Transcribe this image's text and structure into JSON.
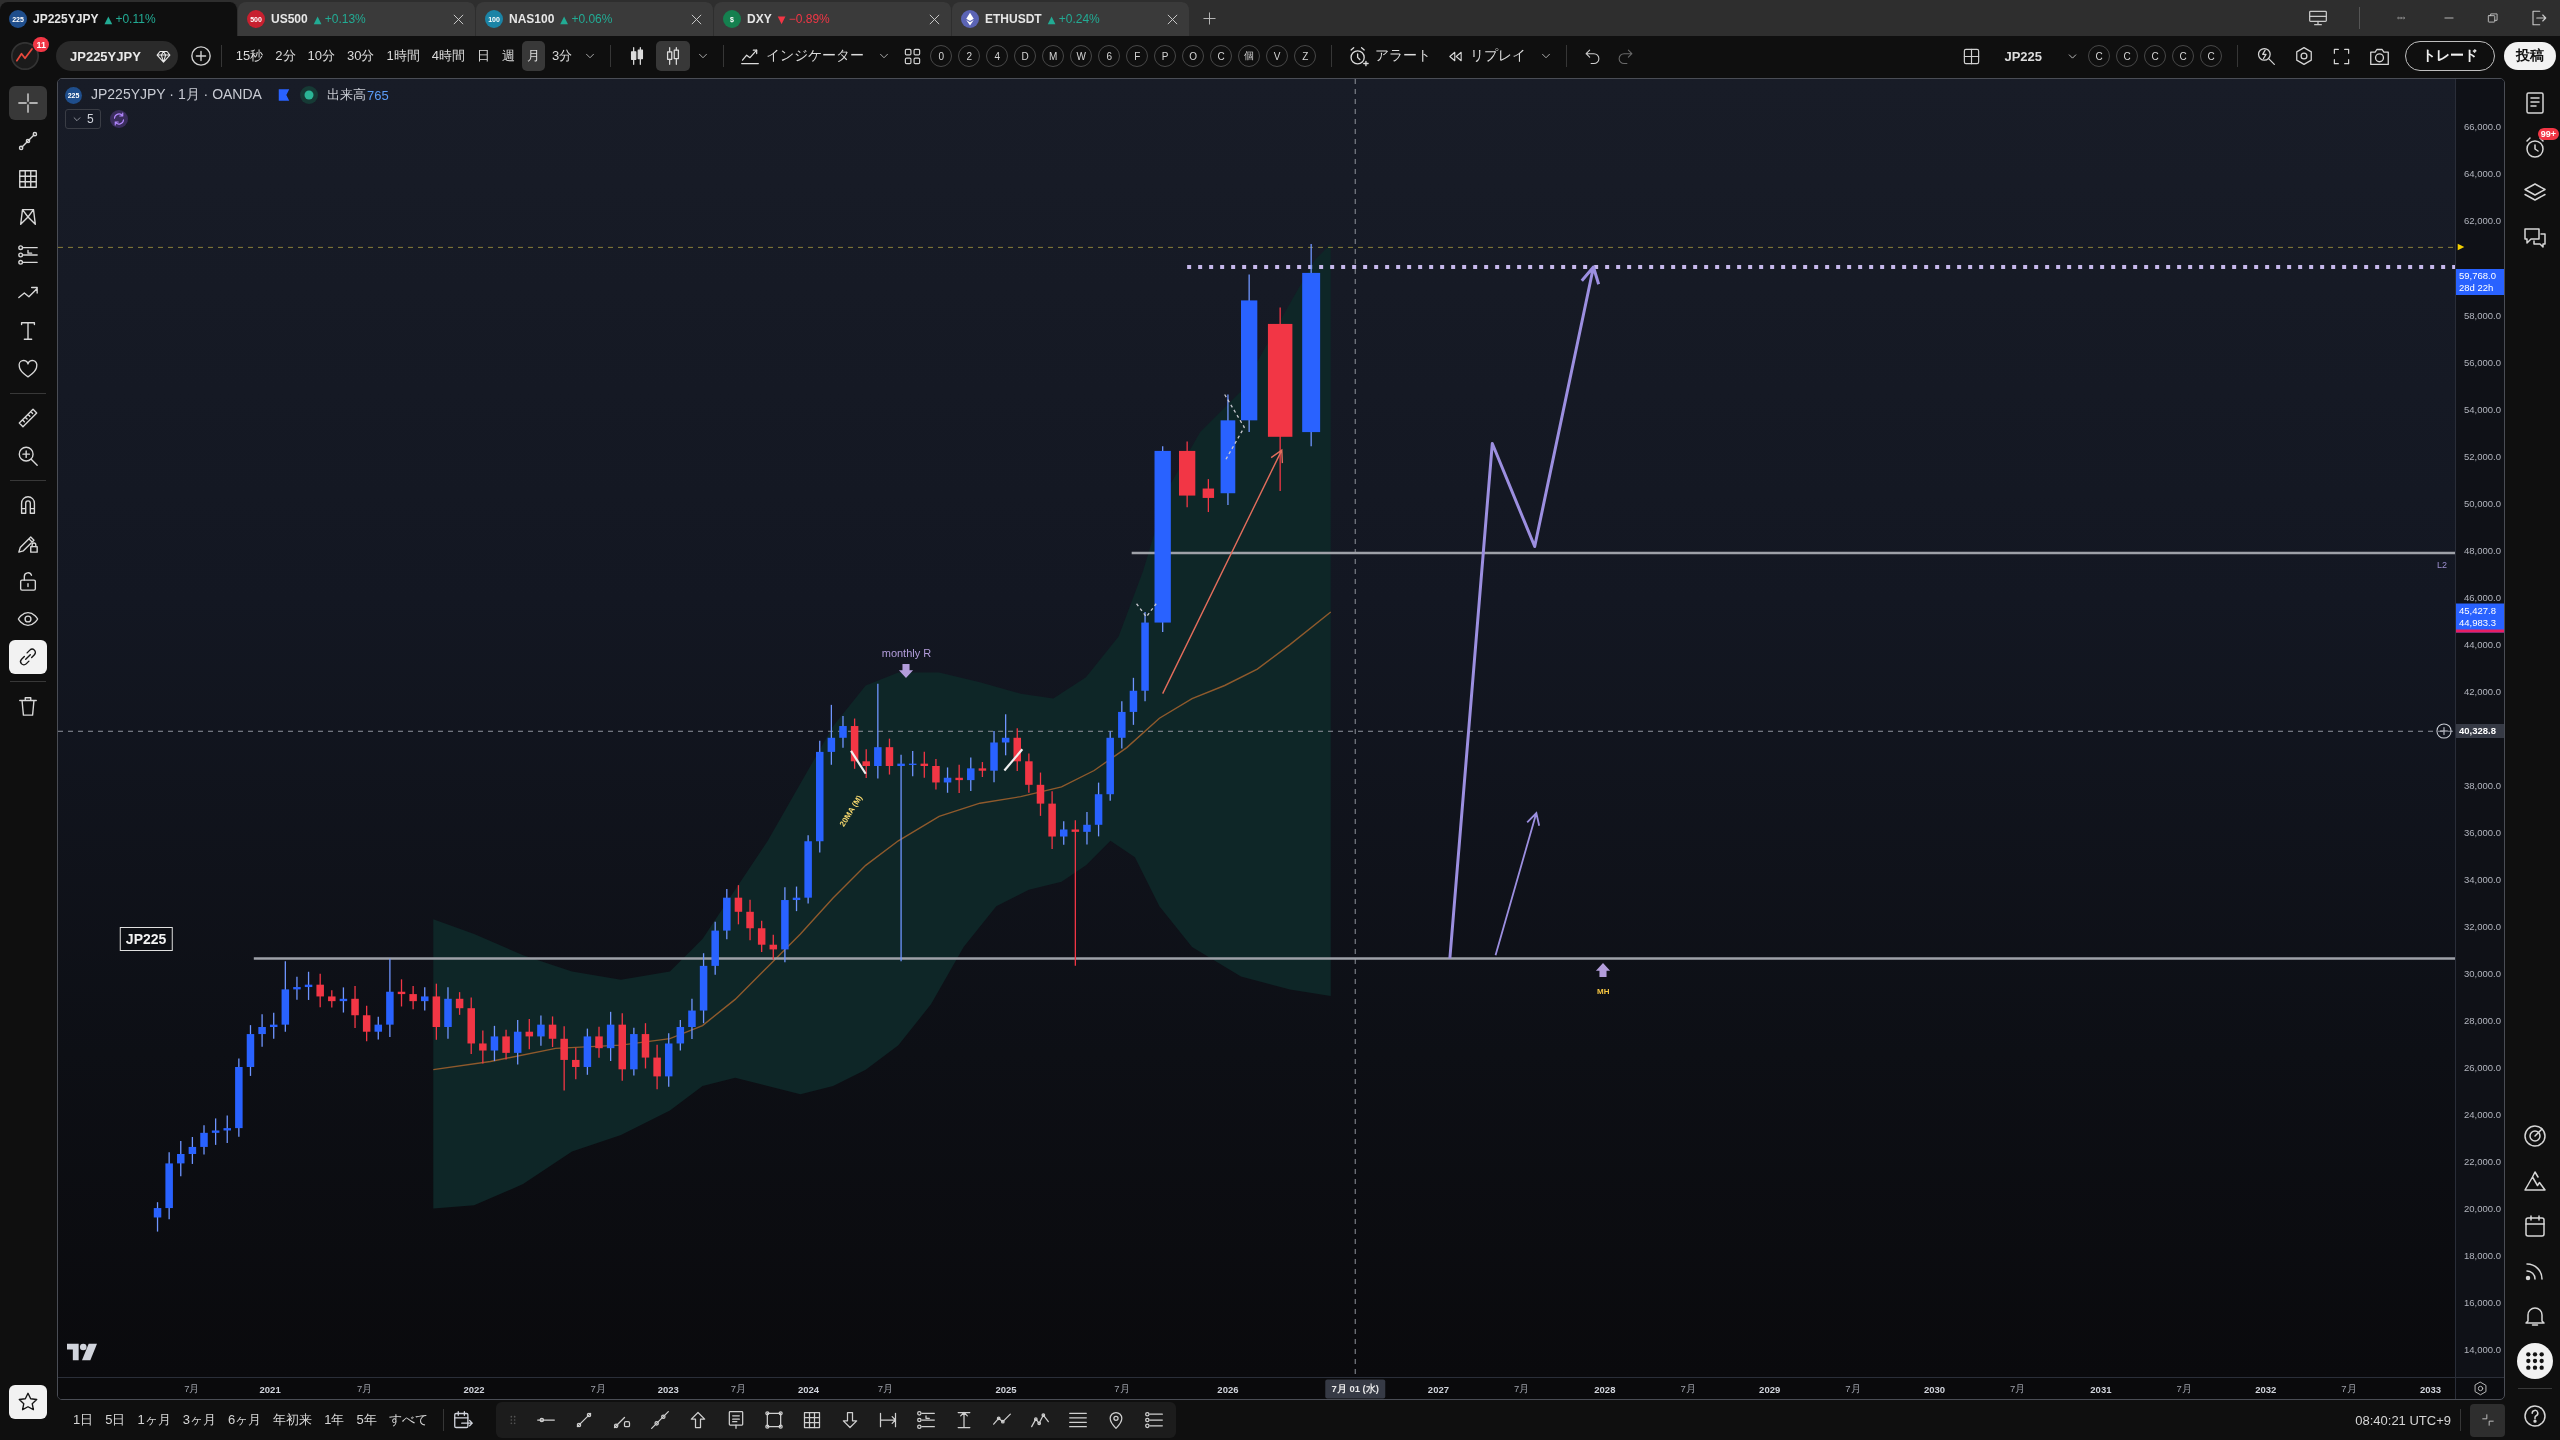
{
  "tabs": [
    {
      "badge": "225",
      "color": "#1f4e8c",
      "symbol": "JP225YJPY",
      "arrow": "▲",
      "negative": false,
      "change": "+0.11%",
      "selected": true,
      "closable": false
    },
    {
      "badge": "500",
      "color": "#c8202f",
      "symbol": "US500",
      "arrow": "▲",
      "negative": false,
      "change": "+0.13%",
      "selected": false,
      "closable": true
    },
    {
      "badge": "100",
      "color": "#1b84a6",
      "symbol": "NAS100",
      "arrow": "▲",
      "negative": false,
      "change": "+0.06%",
      "selected": false,
      "closable": true
    },
    {
      "badge": "$",
      "color": "#15804f",
      "symbol": "DXY",
      "arrow": "▼",
      "negative": true,
      "change": "−0.89%",
      "selected": false,
      "closable": true
    },
    {
      "color": "#5b64b5",
      "symbol": "ETHUSDT",
      "arrow": "▲",
      "negative": false,
      "change": "+0.24%",
      "selected": false,
      "closable": true
    }
  ],
  "toolbar": {
    "notifications": "11",
    "symbol": "JP225YJPY",
    "intervals": [
      {
        "label": "15秒",
        "selected": false
      },
      {
        "label": "2分",
        "selected": false
      },
      {
        "label": "10分",
        "selected": false
      },
      {
        "label": "30分",
        "selected": false
      },
      {
        "label": "1時間",
        "selected": false
      },
      {
        "label": "4時間",
        "selected": false
      },
      {
        "label": "日",
        "selected": false
      },
      {
        "label": "週",
        "selected": false
      },
      {
        "label": "月",
        "selected": true
      },
      {
        "label": "3分",
        "selected": false
      }
    ],
    "chart_types": [
      {
        "kind": "candles",
        "selected": false
      },
      {
        "kind": "hollow_candles",
        "selected": true
      }
    ],
    "indicators": "インジケーター",
    "favorites": [
      "0",
      "2",
      "4",
      "D",
      "M",
      "W",
      "6",
      "F",
      "P",
      "O",
      "C",
      "個",
      "V",
      "Z"
    ],
    "alert": "アラート",
    "replay": "リプレイ",
    "compare_symbol": "JP225",
    "compare": [
      "C",
      "C",
      "C",
      "C",
      "C"
    ],
    "trade": "トレード",
    "publish": "投稿"
  },
  "left_toolbar": {
    "groups": [
      {
        "tools": [
          {
            "kind": "crosshair",
            "selected": true
          },
          {
            "kind": "trend_line",
            "selected": false
          },
          {
            "kind": "fib_grid",
            "selected": false
          },
          {
            "kind": "pattern",
            "selected": false
          },
          {
            "kind": "levels",
            "selected": false
          },
          {
            "kind": "forecast",
            "selected": false
          },
          {
            "kind": "text",
            "selected": false
          },
          {
            "kind": "favorites",
            "selected": false
          }
        ]
      },
      {
        "tools": [
          {
            "kind": "ruler",
            "selected": false
          },
          {
            "kind": "zoom",
            "selected": false
          }
        ]
      },
      {
        "tools": [
          {
            "kind": "magnet",
            "on": false
          },
          {
            "kind": "drawing_lock",
            "on": false
          },
          {
            "kind": "lock",
            "on": false
          },
          {
            "kind": "visibility",
            "on": false
          },
          {
            "kind": "sync",
            "on": true
          }
        ]
      },
      {
        "tools": [
          {
            "kind": "trash"
          }
        ]
      }
    ],
    "star": {
      "on": true
    }
  },
  "chart": {
    "symbol_badge": "225",
    "title": "JP225YJPY · 1月 · OANDA",
    "volume_label": "出来高",
    "volume": "765",
    "collapsed_count": "5",
    "price_axis": [
      "66,000.0",
      "64,000.0",
      "62,000.0",
      "58,000.0",
      "56,000.0",
      "54,000.0",
      "52,000.0",
      "50,000.0",
      "48,000.0",
      "46,000.0",
      "44,000.0",
      "42,000.0",
      "38,000.0",
      "36,000.0",
      "34,000.0",
      "32,000.0",
      "30,000.0",
      "28,000.0",
      "26,000.0",
      "24,000.0",
      "22,000.0",
      "20,000.0",
      "18,000.0",
      "16,000.0",
      "14,000.0"
    ],
    "price_tags": [
      {
        "kind": "last",
        "lines": [
          "59,768.0",
          "28d 22h"
        ]
      },
      {
        "kind": "indicator",
        "lines": [
          "45,427.8",
          "44,983.3"
        ]
      },
      {
        "kind": "crosshair",
        "lines": [
          "40,328.8"
        ]
      }
    ],
    "time_axis": [
      {
        "kind": "month",
        "text": "7月"
      },
      {
        "kind": "year",
        "text": "2021"
      },
      {
        "kind": "month",
        "text": "7月"
      },
      {
        "kind": "year",
        "text": "2022"
      },
      {
        "kind": "month",
        "text": "7月"
      },
      {
        "kind": "year",
        "text": "2023"
      },
      {
        "kind": "month",
        "text": "7月"
      },
      {
        "kind": "year",
        "text": "2024"
      },
      {
        "kind": "month",
        "text": "7月"
      },
      {
        "kind": "year",
        "text": "2025"
      },
      {
        "kind": "month",
        "text": "7月"
      },
      {
        "kind": "year",
        "text": "2026"
      },
      {
        "kind": "crosshair",
        "text": "7月 01 (水)"
      },
      {
        "kind": "year",
        "text": "2027"
      },
      {
        "kind": "month",
        "text": "7月"
      },
      {
        "kind": "year",
        "text": "2028"
      },
      {
        "kind": "month",
        "text": "7月"
      },
      {
        "kind": "year",
        "text": "2029"
      },
      {
        "kind": "month",
        "text": "7月"
      },
      {
        "kind": "year",
        "text": "2030"
      },
      {
        "kind": "month",
        "text": "7月"
      },
      {
        "kind": "year",
        "text": "2031"
      },
      {
        "kind": "month",
        "text": "7月"
      },
      {
        "kind": "year",
        "text": "2032"
      },
      {
        "kind": "month",
        "text": "7月"
      },
      {
        "kind": "year",
        "text": "2033"
      }
    ],
    "annotations": [
      {
        "kind": "note",
        "text": "monthly R"
      },
      {
        "kind": "ma_label",
        "text": "20MA (M)"
      },
      {
        "kind": "box",
        "text": "JP225"
      },
      {
        "kind": "tag",
        "text": "MH"
      },
      {
        "kind": "line_label",
        "text": "L2"
      }
    ]
  },
  "bottom_bar": {
    "ranges": [
      "1日",
      "5日",
      "1ヶ月",
      "3ヶ月",
      "6ヶ月",
      "年初来",
      "1年",
      "5年",
      "すべて"
    ],
    "clock": "08:40:21 UTC+9"
  },
  "right_sidebar": {
    "top": [
      {
        "kind": "watchlist",
        "selected": false
      },
      {
        "kind": "alerts",
        "badge": "99+",
        "selected": false
      },
      {
        "kind": "layers",
        "selected": false
      },
      {
        "kind": "chat",
        "selected": false
      }
    ],
    "bottom": [
      {
        "kind": "gauge",
        "selected": false
      },
      {
        "kind": "mountain",
        "selected": false
      },
      {
        "kind": "calendar",
        "selected": false
      },
      {
        "kind": "broadcast",
        "selected": false
      },
      {
        "kind": "bell",
        "selected": false
      },
      {
        "kind": "apps",
        "selected": true
      },
      {
        "kind": "help",
        "selected": false
      }
    ]
  }
}
